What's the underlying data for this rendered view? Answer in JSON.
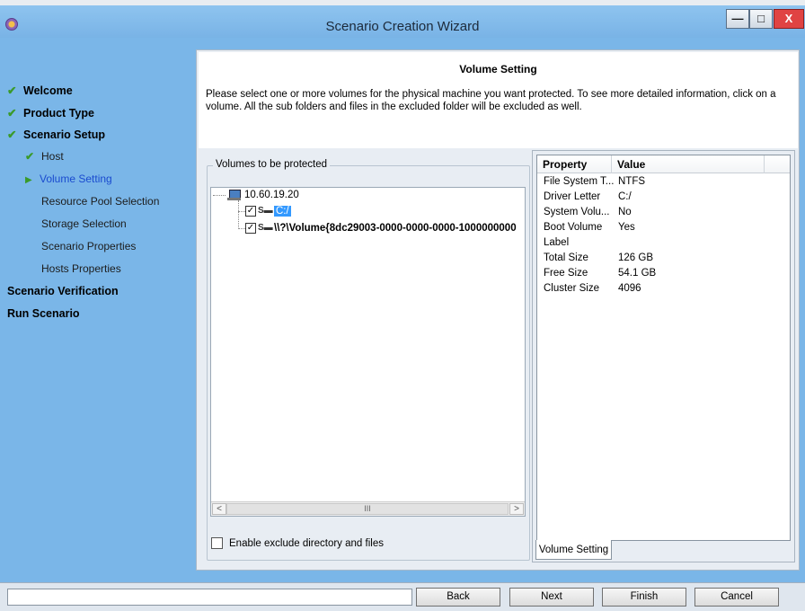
{
  "window": {
    "title": "Scenario Creation Wizard",
    "minimize_label": "—",
    "maximize_label": "□",
    "close_label": "X"
  },
  "sidebar": {
    "items": [
      {
        "label": "Welcome",
        "level": "main",
        "state": "done"
      },
      {
        "label": "Product Type",
        "level": "main",
        "state": "done"
      },
      {
        "label": "Scenario Setup",
        "level": "main",
        "state": "done"
      },
      {
        "label": "Host",
        "level": "sub",
        "state": "done"
      },
      {
        "label": "Volume Setting",
        "level": "sub",
        "state": "current"
      },
      {
        "label": "Resource Pool Selection",
        "level": "sub",
        "state": "pending"
      },
      {
        "label": "Storage Selection",
        "level": "sub",
        "state": "pending"
      },
      {
        "label": "Scenario Properties",
        "level": "sub",
        "state": "pending"
      },
      {
        "label": "Hosts Properties",
        "level": "sub",
        "state": "pending"
      },
      {
        "label": "Scenario Verification",
        "level": "main",
        "state": "pending"
      },
      {
        "label": "Run Scenario",
        "level": "main",
        "state": "pending"
      }
    ]
  },
  "header": {
    "title": "Volume Setting",
    "description": "Please select one or more volumes for the physical machine you want protected. To see more detailed information, click on a volume. All the sub folders and files in the excluded folder will be excluded as well."
  },
  "volumes": {
    "group_label": "Volumes to be protected",
    "host": "10.60.19.20",
    "items": [
      {
        "label": "C:/",
        "checked": true,
        "selected": true
      },
      {
        "label": "\\\\?\\Volume{8dc29003-0000-0000-0000-1000000000",
        "checked": true,
        "selected": false
      }
    ],
    "scroll_left": "<",
    "scroll_thumb": "III",
    "scroll_right": ">",
    "exclude_label": "Enable exclude directory and files"
  },
  "properties": {
    "columns": [
      "Property",
      "Value"
    ],
    "rows": [
      {
        "name": "File System T...",
        "value": "NTFS"
      },
      {
        "name": "Driver Letter",
        "value": "C:/"
      },
      {
        "name": "System Volu...",
        "value": "No"
      },
      {
        "name": "Boot Volume",
        "value": "Yes"
      },
      {
        "name": "Label",
        "value": ""
      },
      {
        "name": "Total Size",
        "value": "126 GB"
      },
      {
        "name": "Free Size",
        "value": "54.1 GB"
      },
      {
        "name": "Cluster Size",
        "value": "4096"
      }
    ],
    "tab_label": "Volume Setting"
  },
  "footer": {
    "status_text": "",
    "back_label": "Back",
    "next_label": "Next",
    "finish_label": "Finish",
    "cancel_label": "Cancel"
  }
}
